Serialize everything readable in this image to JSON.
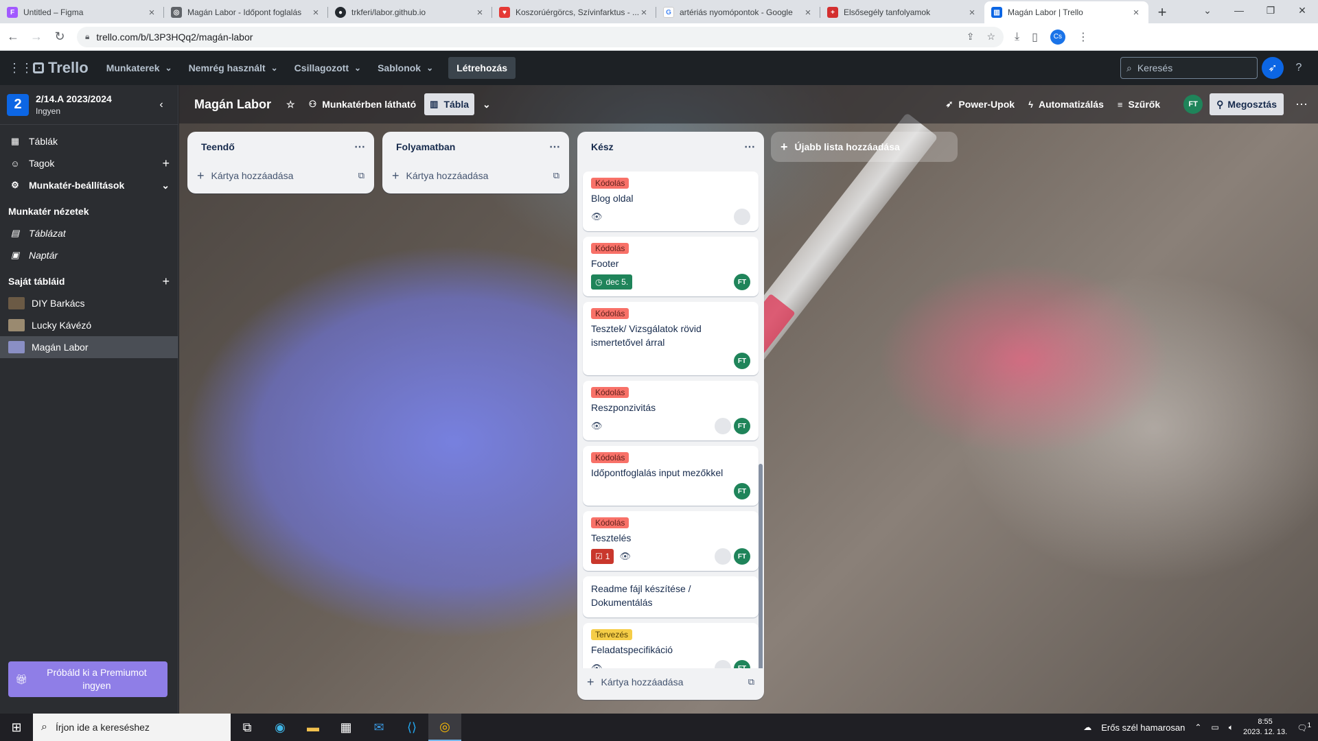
{
  "browser": {
    "tabs": [
      {
        "title": "Untitled – Figma",
        "icon": "figma-icon",
        "color": "#a259ff"
      },
      {
        "title": "Magán Labor - Időpont foglalás",
        "icon": "globe-icon",
        "color": "#5f6368"
      },
      {
        "title": "trkferi/labor.github.io",
        "icon": "github-icon",
        "color": "#24292f"
      },
      {
        "title": "Koszorúérgörcs, Szívinfarktus - ...",
        "icon": "heart-icon",
        "color": "#e53935"
      },
      {
        "title": "artériás nyomópontok - Google",
        "icon": "google-icon",
        "color": "#4285f4"
      },
      {
        "title": "Elsősegély tanfolyamok",
        "icon": "cross-icon",
        "color": "#d32f2f"
      },
      {
        "title": "Magán Labor | Trello",
        "icon": "trello-icon",
        "color": "#0c66e4"
      }
    ],
    "new_tab": "+",
    "url": "trello.com/b/L3P3HQq2/magán-labor",
    "profile_initials": "Cs"
  },
  "header": {
    "logo": "Trello",
    "menus": [
      "Munkaterek",
      "Nemrég használt",
      "Csillagozott",
      "Sablonok"
    ],
    "create": "Létrehozás",
    "search_placeholder": "Keresés"
  },
  "sidebar": {
    "workspace_badge": "2",
    "workspace_name": "2/14.A 2023/2024",
    "workspace_plan": "Ingyen",
    "items": [
      {
        "label": "Táblák",
        "icon": "board-icon"
      },
      {
        "label": "Tagok",
        "icon": "person-icon"
      },
      {
        "label": "Munkatér-beállítások",
        "icon": "gear-icon"
      }
    ],
    "views_heading": "Munkatér nézetek",
    "views": [
      {
        "label": "Táblázat",
        "icon": "table-icon"
      },
      {
        "label": "Naptár",
        "icon": "calendar-icon"
      }
    ],
    "boards_heading": "Saját tábláid",
    "boards": [
      {
        "label": "DIY Barkács",
        "color": "#6b5a45"
      },
      {
        "label": "Lucky Kávézó",
        "color": "#9a8a70"
      },
      {
        "label": "Magán Labor",
        "color": "#8a8fc4"
      }
    ],
    "premium": "Próbáld ki a Premiumot ingyen"
  },
  "board": {
    "title": "Magán Labor",
    "visibility": "Munkatérben látható",
    "view": "Tábla",
    "powerups": "Power-Upok",
    "automation": "Automatizálás",
    "filters": "Szűrők",
    "member_initials": "FT",
    "share": "Megosztás",
    "add_card": "Kártya hozzáadása",
    "add_list": "Újabb lista hozzáadása",
    "lists": [
      {
        "title": "Teendő"
      },
      {
        "title": "Folyamatban"
      },
      {
        "title": "Kész"
      }
    ],
    "cards": [
      {
        "label": "Kódolás",
        "title": "Blog oldal",
        "watch": true,
        "ghost": true,
        "member": false
      },
      {
        "label": "Kódolás",
        "title": "Footer",
        "due": "dec 5.",
        "member": true
      },
      {
        "label": "Kódolás",
        "title": "Tesztek/ Vizsgálatok rövid ismertetővel árral",
        "member": true
      },
      {
        "label": "Kódolás",
        "title": "Reszponzivitás",
        "watch": true,
        "ghost": true,
        "member": true
      },
      {
        "label": "Kódolás",
        "title": "Időpontfoglalás input mezőkkel",
        "member": true
      },
      {
        "label": "Kódolás",
        "title": "Tesztelés",
        "checklist": "1",
        "watch": true,
        "ghost": true,
        "member": true
      },
      {
        "title": "Readme fájl készítése / Dokumentálás"
      },
      {
        "label": "Tervezés",
        "label_color": "yellow",
        "title": "Feladatspecifikáció",
        "watch": true,
        "ghost": true,
        "member": true
      }
    ]
  },
  "taskbar": {
    "search_placeholder": "Írjon ide a kereséshez",
    "weather": "Erős szél hamarosan",
    "time": "8:55",
    "date": "2023. 12. 13.",
    "notifications": "1"
  }
}
